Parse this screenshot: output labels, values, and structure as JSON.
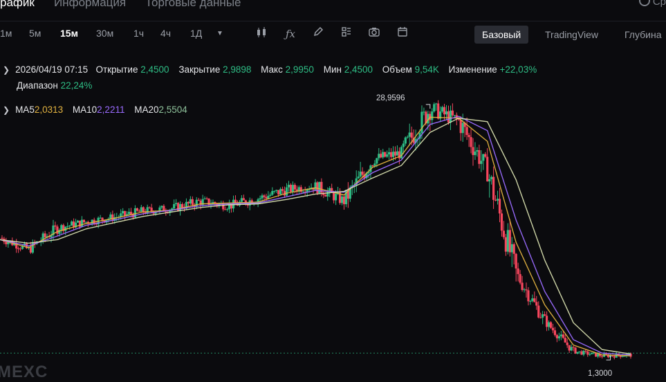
{
  "tabs": [
    "рафик",
    "Информация",
    "Торговые данные"
  ],
  "top_right": "Ср",
  "timeframes": [
    "1м",
    "5м",
    "15м",
    "30м",
    "1ч",
    "4ч",
    "1Д"
  ],
  "active_timeframe": "15м",
  "view_buttons": [
    "Базовый",
    "TradingView",
    "Глубина"
  ],
  "active_view": "Базовый",
  "toolbar_icons": [
    "candles-icon",
    "indicator-fx-icon",
    "draw-pencil-icon",
    "layout-icon",
    "screenshot-icon",
    "calendar-icon"
  ],
  "ohlc": {
    "date": "2026/04/19 07:15",
    "open_label": "Открытие",
    "open": "2,4500",
    "close_label": "Закрытие",
    "close": "2,9898",
    "high_label": "Макс",
    "high": "2,9950",
    "low_label": "Мин",
    "low": "2,4500",
    "volume_label": "Объем",
    "volume": "9,54K",
    "change_label": "Изменение",
    "change": "+22,03%",
    "range_label": "Диапазон",
    "range": "22,24%"
  },
  "ma": {
    "ma5_label": "MA5",
    "ma5": "2,0313",
    "ma10_label": "MA10",
    "ma10": "2,2211",
    "ma20_label": "MA20",
    "ma20": "2,5504"
  },
  "chart_labels": {
    "max_price": "28,9596",
    "min_price": "1,3000"
  },
  "watermark": "MEXC",
  "colors": {
    "up": "#2ebd85",
    "down": "#f6465d",
    "ma5": "#e3b341",
    "ma10": "#9a6bff",
    "ma20": "#d9e0b0",
    "bg": "#0b0b0e"
  },
  "chart_data": {
    "type": "line",
    "description_series": "price (candles)",
    "series": [
      {
        "name": "MA5",
        "values": [
          14.3,
          13.4,
          15.2,
          16.1,
          16.7,
          17.4,
          17.6,
          18.3,
          18.4,
          18.5,
          19.5,
          20.1,
          19.3,
          22.4,
          23.7,
          28.0,
          27.9,
          25.3,
          14.0,
          7.0,
          2.5,
          1.4,
          1.3
        ]
      },
      {
        "name": "MA10",
        "values": [
          14.3,
          13.6,
          14.7,
          15.9,
          16.5,
          17.2,
          17.6,
          18.1,
          18.3,
          18.4,
          19.1,
          19.8,
          19.6,
          21.8,
          23.2,
          27.2,
          28.1,
          26.5,
          16.5,
          8.5,
          3.1,
          1.6,
          1.4
        ]
      },
      {
        "name": "MA20",
        "values": [
          14.3,
          13.9,
          14.3,
          15.5,
          16.2,
          16.9,
          17.4,
          17.9,
          18.2,
          18.3,
          18.8,
          19.4,
          19.7,
          21.2,
          22.6,
          26.3,
          27.9,
          27.5,
          21.0,
          12.0,
          5.0,
          2.0,
          1.5
        ]
      }
    ],
    "candles_close": [
      14.5,
      13.2,
      15.6,
      16.3,
      16.8,
      17.5,
      17.8,
      18.6,
      18.1,
      18.9,
      19.9,
      20.3,
      18.6,
      23.3,
      24.0,
      29.0,
      27.6,
      22.0,
      10.5,
      5.2,
      1.8,
      1.3,
      1.4
    ],
    "max_marker": 28.9596,
    "min_marker": 1.3,
    "current_price_line": 1.6
  }
}
